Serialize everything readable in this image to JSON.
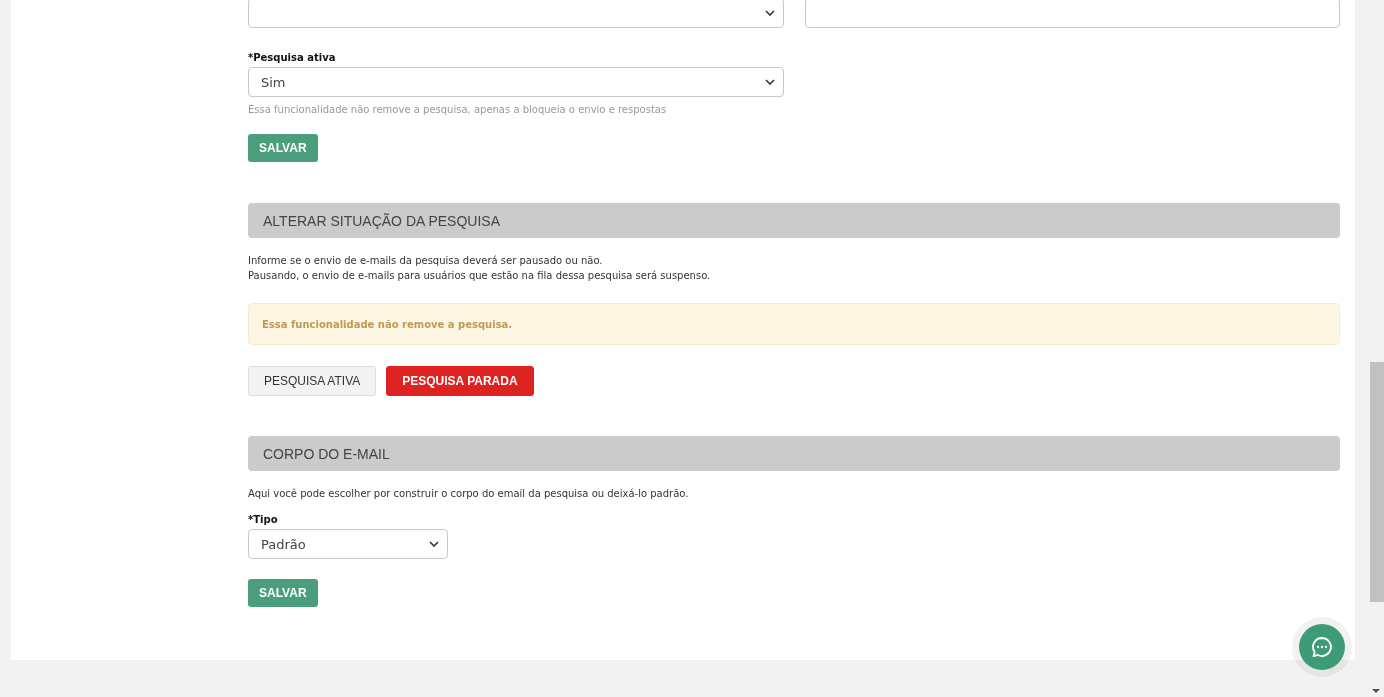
{
  "top_fields": [
    {
      "kind": "select"
    },
    {
      "kind": "input"
    }
  ],
  "active_field": {
    "label": "*Pesquisa ativa",
    "value": "Sim",
    "hint": "Essa funcionalidade não remove a pesquisa, apenas a bloqueia o envio e respostas",
    "button": "SALVAR"
  },
  "status_section": {
    "title": "ALTERAR SITUAÇÃO DA PESQUISA",
    "lines": [
      "Informe se o envio de e-mails da pesquisa deverá ser pausado ou não.",
      "Pausando, o envio de e-mails para usuários que estão na fila dessa pesquisa será suspenso."
    ],
    "alert": "Essa funcionalidade não remove a pesquisa.",
    "options": [
      {
        "label": "PESQUISA ATIVA",
        "selected": false
      },
      {
        "label": "PESQUISA PARADA",
        "selected": true
      }
    ]
  },
  "email_section": {
    "title": "CORPO DO E-MAIL",
    "description": "Aqui você pode escolher por construir o corpo do email da pesquisa ou deixá-lo padrão.",
    "label": "*Tipo",
    "value": "Padrão",
    "button": "SALVAR"
  }
}
